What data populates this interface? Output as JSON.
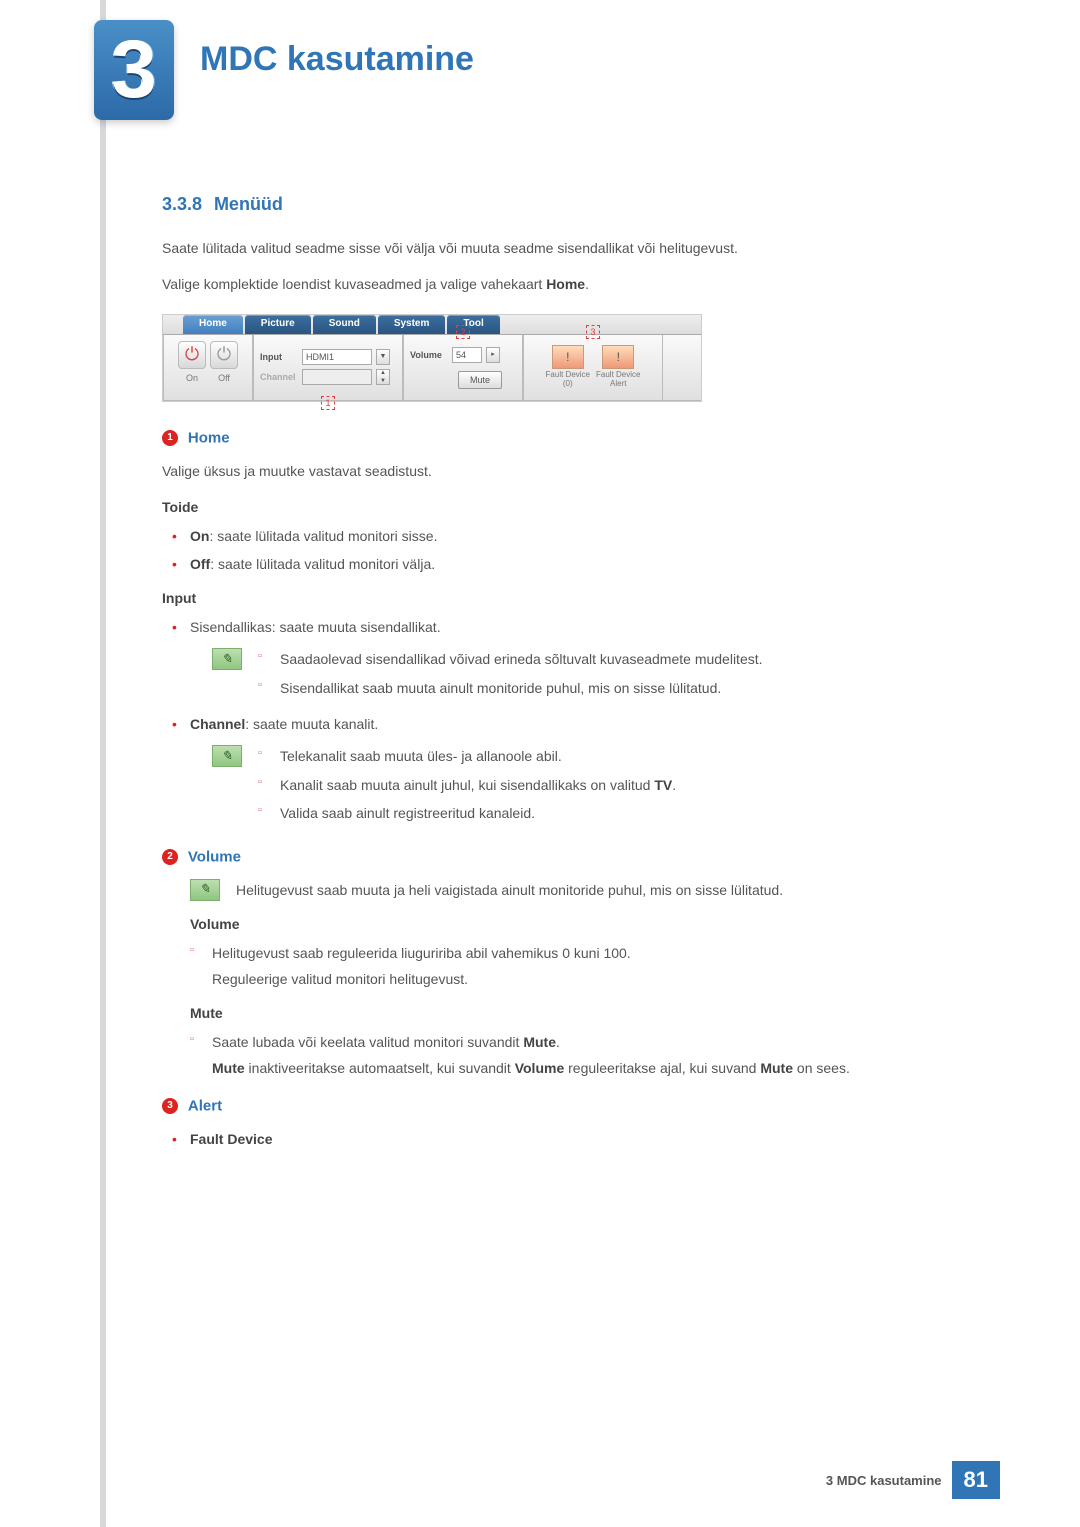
{
  "chapter": {
    "number": "3",
    "title": "MDC kasutamine"
  },
  "section": {
    "number": "3.3.8",
    "title": "Menüüd"
  },
  "intro": {
    "p1": "Saate lülitada valitud seadme sisse või välja või muuta seadme sisendallikat või helitugevust.",
    "p2_a": "Valige komplektide loendist kuvaseadmed ja valige vahekaart ",
    "p2_b": "Home",
    "p2_c": "."
  },
  "mock": {
    "tabs": [
      "Home",
      "Picture",
      "Sound",
      "System",
      "Tool"
    ],
    "power": {
      "on": "On",
      "off": "Off"
    },
    "input": {
      "label": "Input",
      "value": "HDMI1"
    },
    "channel": {
      "label": "Channel"
    },
    "volume": {
      "label": "Volume",
      "value": "54"
    },
    "mute": "Mute",
    "fault1a": "Fault Device",
    "fault1b": "(0)",
    "fault2a": "Fault Device",
    "fault2b": "Alert",
    "callouts": {
      "c1": "1",
      "c2": "2",
      "c3": "3"
    }
  },
  "s1": {
    "num": "1",
    "title": "Home",
    "p": "Valige üksus ja muutke vastavat seadistust.",
    "toide": {
      "title": "Toide",
      "on_b": "On",
      "on_t": ": saate lülitada valitud monitori sisse.",
      "off_b": "Off",
      "off_t": ": saate lülitada valitud monitori välja."
    },
    "input": {
      "title": "Input",
      "src": "Sisendallikas: saate muuta sisendallikat.",
      "note1": "Saadaolevad sisendallikad võivad erineda sõltuvalt kuvaseadmete mudelitest.",
      "note2": "Sisendallikat saab muuta ainult monitoride puhul, mis on sisse lülitatud.",
      "ch_b": "Channel",
      "ch_t": ": saate muuta kanalit.",
      "chn1": "Telekanalit saab muuta üles- ja allanoole abil.",
      "chn2_a": "Kanalit saab muuta ainult juhul, kui sisendallikaks on valitud ",
      "chn2_b": "TV",
      "chn2_c": ".",
      "chn3": "Valida saab ainult registreeritud kanaleid."
    }
  },
  "s2": {
    "num": "2",
    "title": "Volume",
    "note": "Helitugevust saab muuta ja heli vaigistada ainult monitoride puhul, mis on sisse lülitatud.",
    "vol": {
      "title": "Volume",
      "p1": "Helitugevust saab reguleerida liuguririba abil vahemikus 0 kuni 100.",
      "p2": "Reguleerige valitud monitori helitugevust."
    },
    "mute": {
      "title": "Mute",
      "p1_a": "Saate lubada või keelata valitud monitori suvandit ",
      "p1_b": "Mute",
      "p1_c": ".",
      "p2_a": "Mute",
      "p2_b": " inaktiveeritakse automaatselt, kui suvandit ",
      "p2_c": "Volume",
      "p2_d": " reguleeritakse ajal, kui suvand ",
      "p2_e": "Mute",
      "p2_f": " on sees."
    }
  },
  "s3": {
    "num": "3",
    "title": "Alert",
    "item": "Fault Device"
  },
  "footer": {
    "text": "3 MDC kasutamine",
    "page": "81"
  }
}
